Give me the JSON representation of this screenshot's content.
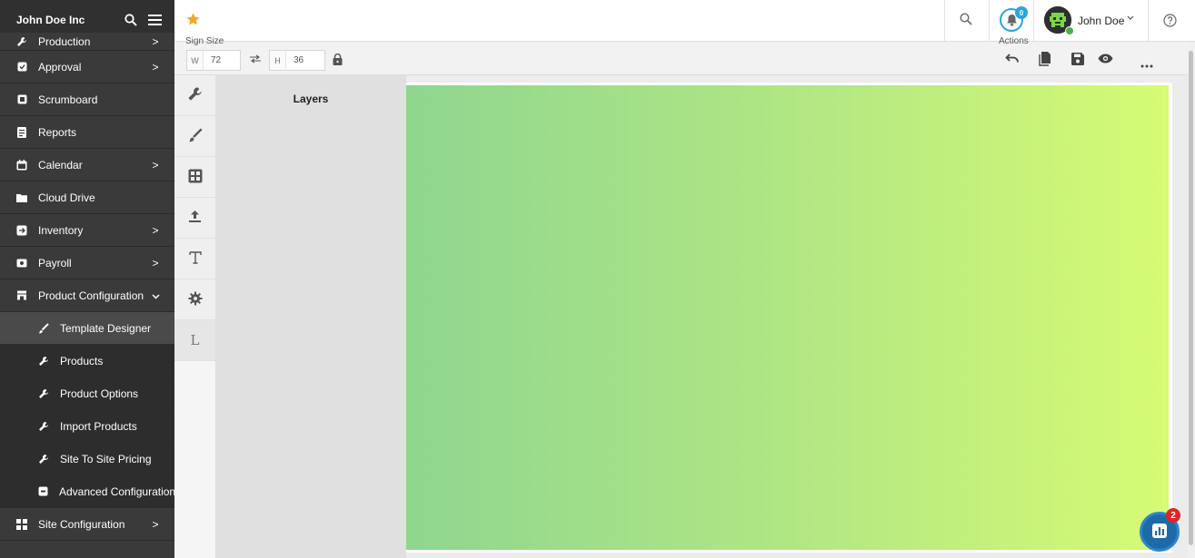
{
  "app": {
    "company": "John Doe Inc"
  },
  "sidebar": {
    "items": [
      {
        "label": "Production",
        "icon": "wrench-icon",
        "chevron": ">"
      },
      {
        "label": "Approval",
        "icon": "approval-icon",
        "chevron": ">"
      },
      {
        "label": "Scrumboard",
        "icon": "board-icon",
        "chevron": ""
      },
      {
        "label": "Reports",
        "icon": "reports-icon",
        "chevron": ""
      },
      {
        "label": "Calendar",
        "icon": "calendar-icon",
        "chevron": ">"
      },
      {
        "label": "Cloud Drive",
        "icon": "folder-icon",
        "chevron": ""
      },
      {
        "label": "Inventory",
        "icon": "inventory-icon",
        "chevron": ">"
      },
      {
        "label": "Payroll",
        "icon": "payroll-icon",
        "chevron": ">"
      },
      {
        "label": "Product Configuration",
        "icon": "store-icon",
        "chevron": "v"
      }
    ],
    "subitems": [
      {
        "label": "Template Designer",
        "icon": "brush-icon",
        "active": true,
        "chevron": ""
      },
      {
        "label": "Products",
        "icon": "wrench-icon",
        "active": false,
        "chevron": ""
      },
      {
        "label": "Product Options",
        "icon": "wrench-icon",
        "active": false,
        "chevron": ""
      },
      {
        "label": "Import Products",
        "icon": "wrench-icon",
        "active": false,
        "chevron": ""
      },
      {
        "label": "Site To Site Pricing",
        "icon": "wrench-icon",
        "active": false,
        "chevron": ""
      },
      {
        "label": "Advanced Configuration",
        "icon": "settings-box-icon",
        "active": false,
        "chevron": ">"
      }
    ],
    "footer_item": {
      "label": "Site Configuration",
      "icon": "grid-icon",
      "chevron": ">"
    }
  },
  "topbar": {
    "notifications_count": "0",
    "user_name": "John Doe"
  },
  "toolbar": {
    "size_label": "Sign Size",
    "width_prefix": "W",
    "width_value": "72",
    "height_prefix": "H",
    "height_value": "36",
    "actions_label": "Actions"
  },
  "layers": {
    "title": "Layers"
  },
  "rail": {
    "last_label": "L"
  },
  "fab": {
    "badge": "2"
  },
  "colors": {
    "sidebar_bg": "#3a3a3a",
    "accent": "#2aa7d8",
    "star": "#f5a623",
    "canvas_gradient_start": "#8fd68f",
    "canvas_gradient_end": "#d6fb74"
  }
}
